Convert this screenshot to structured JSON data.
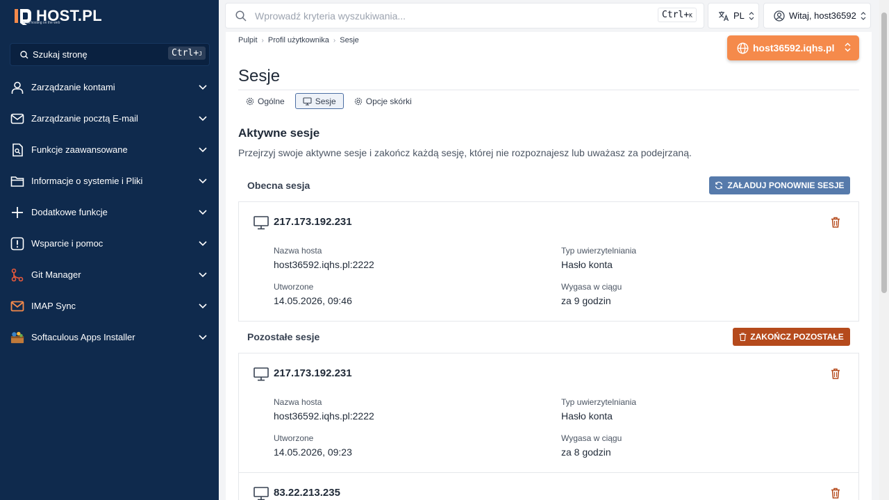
{
  "brand": {
    "name": "HOST.PL",
    "tagline": "Best hosting on the web"
  },
  "sidebar": {
    "search": {
      "placeholder": "Szukaj stronę",
      "shortcut": "Ctrl+",
      "shortcut_key": "J"
    },
    "items": [
      {
        "label": "Zarządzanie kontami",
        "icon": "user-icon"
      },
      {
        "label": "Zarządzanie pocztą E-mail",
        "icon": "mail-icon"
      },
      {
        "label": "Funkcje zaawansowane",
        "icon": "advanced-icon"
      },
      {
        "label": "Informacje o systemie i Pliki",
        "icon": "folder-icon"
      },
      {
        "label": "Dodatkowe funkcje",
        "icon": "plus-icon"
      },
      {
        "label": "Wsparcie i pomoc",
        "icon": "alert-icon"
      },
      {
        "label": "Git Manager",
        "icon": "git-icon"
      },
      {
        "label": "IMAP Sync",
        "icon": "imap-icon"
      },
      {
        "label": "Softaculous Apps Installer",
        "icon": "softaculous-icon"
      }
    ]
  },
  "topbar": {
    "search": {
      "placeholder": "Wprowadź kryteria wyszukiwania...",
      "shortcut": "Ctrl+",
      "shortcut_key": "K"
    },
    "language": "PL",
    "user": "Witaj, host36592"
  },
  "breadcrumb": [
    "Pulpit",
    "Profil użytkownika",
    "Sesje"
  ],
  "domain_selector": "host36592.iqhs.pl",
  "page": {
    "title": "Sesje",
    "tabs": [
      {
        "label": "Ogólne",
        "active": false
      },
      {
        "label": "Sesje",
        "active": true
      },
      {
        "label": "Opcje skórki",
        "active": false
      }
    ],
    "section_title": "Aktywne sesje",
    "section_desc": "Przejrzyj swoje aktywne sesje i zakończ każdą sesję, której nie rozpoznajesz lub uważasz za podejrzaną."
  },
  "current": {
    "heading": "Obecna sesja",
    "reload_label": "ZAŁADUJ PONOWNIE SESJE",
    "session": {
      "ip": "217.173.192.231",
      "host_label": "Nazwa hosta",
      "host": "host36592.iqhs.pl:2222",
      "auth_label": "Typ uwierzytelniania",
      "auth": "Hasło konta",
      "created_label": "Utworzone",
      "created": "14.05.2026, 09:46",
      "expires_label": "Wygasa w ciągu",
      "expires": "za 9 godzin"
    }
  },
  "others": {
    "heading": "Pozostałe sesje",
    "end_label": "ZAKOŃCZ POZOSTAŁE",
    "sessions": [
      {
        "ip": "217.173.192.231",
        "host_label": "Nazwa hosta",
        "host": "host36592.iqhs.pl:2222",
        "auth_label": "Typ uwierzytelniania",
        "auth": "Hasło konta",
        "created_label": "Utworzone",
        "created": "14.05.2026, 09:23",
        "expires_label": "Wygasa w ciągu",
        "expires": "za 8 godzin"
      },
      {
        "ip": "83.22.213.235"
      }
    ]
  },
  "colors": {
    "sidebar": "#0f2a4d",
    "accent": "#f58a4b",
    "reload": "#567aab",
    "danger": "#b54a1c"
  }
}
